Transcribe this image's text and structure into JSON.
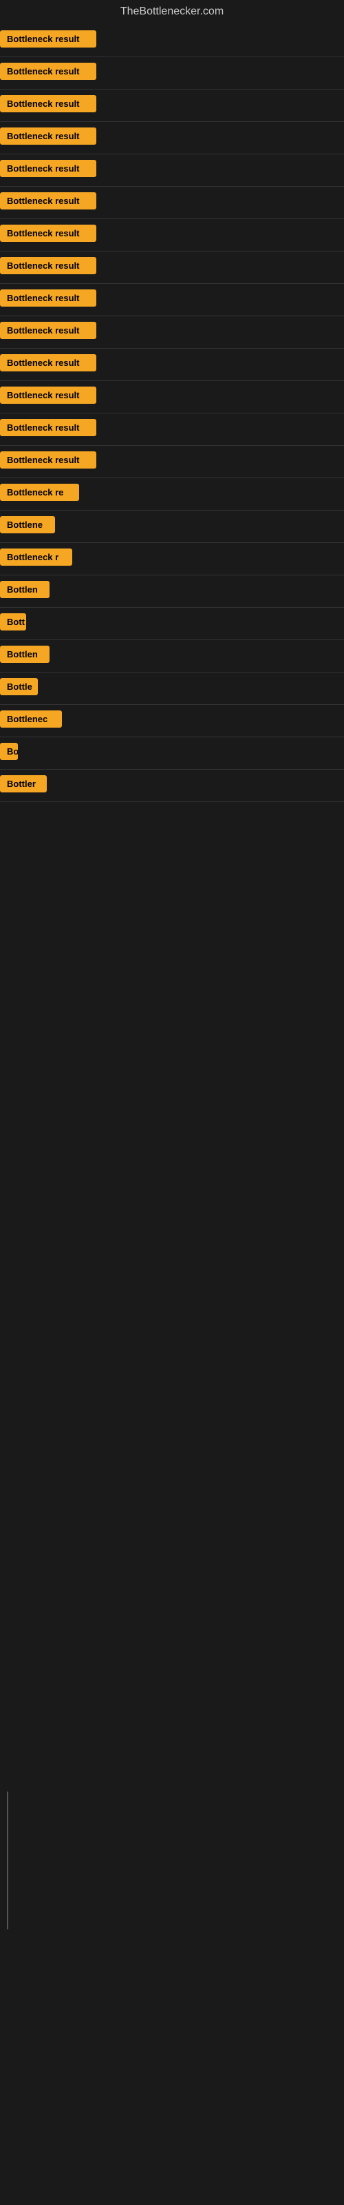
{
  "header": {
    "title": "TheBottlenecker.com"
  },
  "items": [
    {
      "label": "Bottleneck result",
      "width": "full"
    },
    {
      "label": "Bottleneck result",
      "width": "full"
    },
    {
      "label": "Bottleneck result",
      "width": "full"
    },
    {
      "label": "Bottleneck result",
      "width": "full"
    },
    {
      "label": "Bottleneck result",
      "width": "full"
    },
    {
      "label": "Bottleneck result",
      "width": "full"
    },
    {
      "label": "Bottleneck result",
      "width": "full"
    },
    {
      "label": "Bottleneck result",
      "width": "full"
    },
    {
      "label": "Bottleneck result",
      "width": "full"
    },
    {
      "label": "Bottleneck result",
      "width": "full"
    },
    {
      "label": "Bottleneck result",
      "width": "full"
    },
    {
      "label": "Bottleneck result",
      "width": "full"
    },
    {
      "label": "Bottleneck result",
      "width": "full"
    },
    {
      "label": "Bottleneck result",
      "width": "full"
    },
    {
      "label": "Bottleneck re",
      "width": "partial1"
    },
    {
      "label": "Bottlene",
      "width": "partial2"
    },
    {
      "label": "Bottleneck r",
      "width": "partial3"
    },
    {
      "label": "Bottlen",
      "width": "partial4"
    },
    {
      "label": "Bott",
      "width": "partial5"
    },
    {
      "label": "Bottlen",
      "width": "partial6"
    },
    {
      "label": "Bottle",
      "width": "partial7"
    },
    {
      "label": "Bottlenec",
      "width": "partial8"
    },
    {
      "label": "Bo",
      "width": "partial9"
    },
    {
      "label": "Bottler",
      "width": "partial10"
    }
  ],
  "colors": {
    "badge_bg": "#f5a623",
    "badge_text": "#000000",
    "bg": "#1a1a1a",
    "title_color": "#cccccc"
  }
}
